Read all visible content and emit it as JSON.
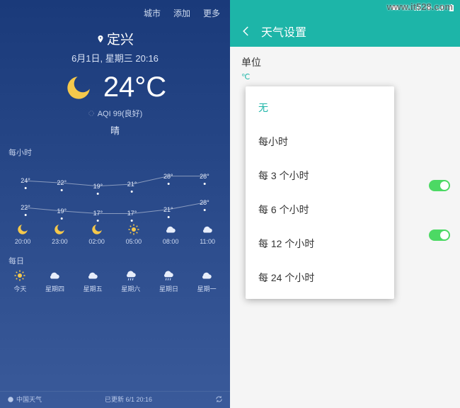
{
  "watermark": "www.it528.com",
  "left": {
    "header": {
      "city": "城市",
      "add": "添加",
      "more": "更多"
    },
    "location": "定兴",
    "datetime": "6月1日, 星期三 20:16",
    "temperature": "24°C",
    "aqi": "AQI 99(良好)",
    "condition": "晴",
    "hourly_label": "每小时",
    "daily_label": "每日",
    "chart_data": {
      "type": "line",
      "series": [
        {
          "name": "high",
          "values": [
            "24°",
            "22°",
            "19°",
            "21°",
            "28°",
            "28°"
          ]
        },
        {
          "name": "low",
          "values": [
            "22°",
            "19°",
            "17°",
            "17°",
            "21°",
            "28°"
          ]
        }
      ],
      "categories": [
        "20:00",
        "23:00",
        "02:00",
        "05:00",
        "08:00",
        "11:00"
      ],
      "icons": [
        "moon",
        "moon",
        "moon",
        "sun",
        "cloud",
        "cloud"
      ]
    },
    "daily": [
      {
        "day": "今天",
        "icon": "sun"
      },
      {
        "day": "星期四",
        "icon": "cloud"
      },
      {
        "day": "星期五",
        "icon": "cloud"
      },
      {
        "day": "星期六",
        "icon": "rain"
      },
      {
        "day": "星期日",
        "icon": "rain"
      },
      {
        "day": "星期一",
        "icon": "cloud"
      }
    ],
    "footer": {
      "brand": "中国天气",
      "updated": "已更新 6/1 20:16"
    }
  },
  "right": {
    "status_icons": [
      "square",
      "hd",
      "signal",
      "wifi",
      "signal",
      "battery",
      "clock"
    ],
    "appbar_title": "天气设置",
    "setting": {
      "title": "单位",
      "value": "℃"
    },
    "toggles": [
      true,
      true
    ],
    "dropdown": {
      "selected": "无",
      "items": [
        "无",
        "每小时",
        "每 3 个小时",
        "每 6 个小时",
        "每 12 个小时",
        "每 24 个小时"
      ]
    }
  }
}
